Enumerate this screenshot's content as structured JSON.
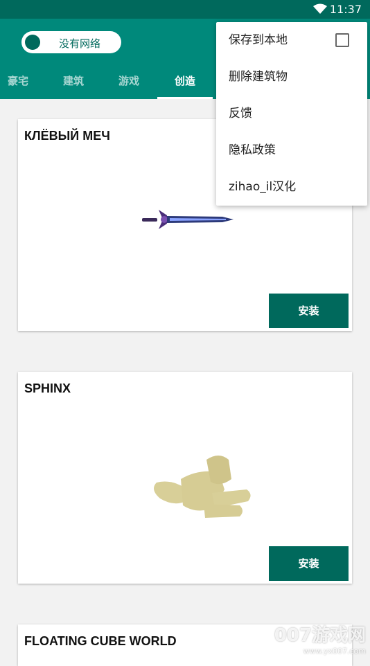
{
  "status_bar": {
    "time": "11:37"
  },
  "network_toggle": {
    "label": "没有网络"
  },
  "tabs": [
    {
      "label": "豪宅"
    },
    {
      "label": "建筑"
    },
    {
      "label": "游戏"
    },
    {
      "label": "创造"
    }
  ],
  "cards": [
    {
      "title": "КЛЁВЫЙ МЕЧ",
      "button": "安装"
    },
    {
      "title": "SPHINX",
      "button": "安装"
    },
    {
      "title": "FLOATING CUBE WORLD"
    }
  ],
  "menu": {
    "items": [
      {
        "label": "保存到本地",
        "checked": false
      },
      {
        "label": "删除建筑物"
      },
      {
        "label": "反馈"
      },
      {
        "label": "隐私政策"
      },
      {
        "label": "zihao_il汉化"
      }
    ]
  },
  "watermark": {
    "text": "007游戏网",
    "url": "www.yx007.com"
  },
  "colors": {
    "primary_dark": "#00695c",
    "primary": "#00897b",
    "background": "#f2f2f2"
  }
}
